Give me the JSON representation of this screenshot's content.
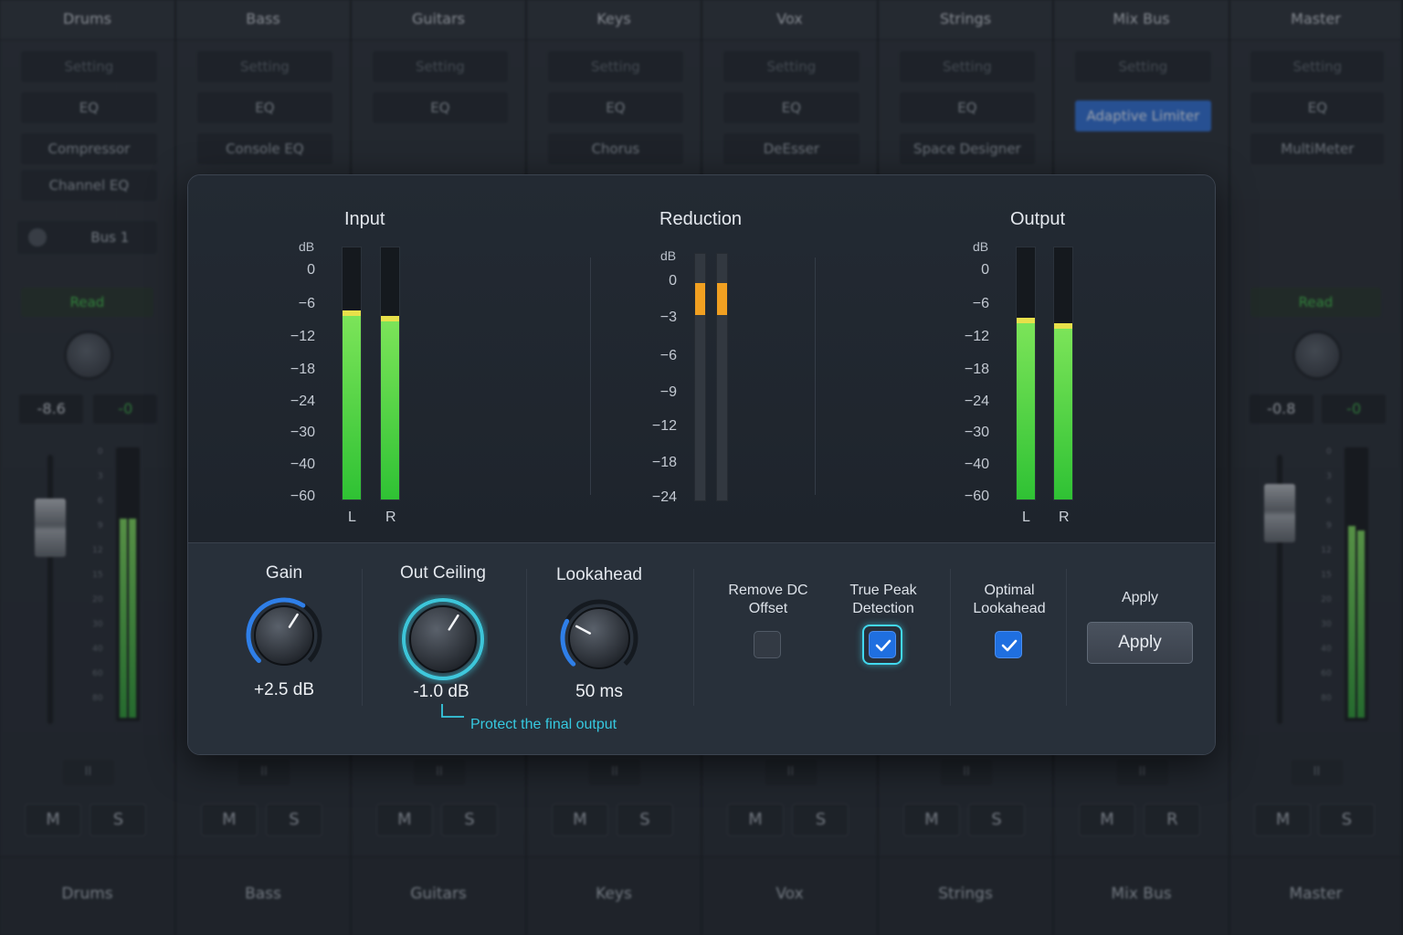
{
  "mixer": {
    "strips": [
      {
        "name": "Drums",
        "setting": "Setting",
        "slots": [
          "EQ",
          "Compressor",
          "Channel EQ"
        ],
        "bus": "Bus 1",
        "read": "Read",
        "volume": "-8.6",
        "volume2": "-0",
        "mute": "M",
        "solo": "S",
        "pause": "II"
      },
      {
        "name": "Bass",
        "setting": "Setting",
        "slots": [
          "EQ",
          "Console EQ"
        ],
        "mute": "M",
        "solo": "S",
        "pause": "II"
      },
      {
        "name": "Guitars",
        "setting": "Setting",
        "slots": [
          "EQ"
        ],
        "mute": "M",
        "solo": "S",
        "pause": "II"
      },
      {
        "name": "Keys",
        "setting": "Setting",
        "slots": [
          "EQ",
          "Chorus"
        ],
        "mute": "M",
        "solo": "S",
        "pause": "II"
      },
      {
        "name": "Vox",
        "setting": "Setting",
        "slots": [
          "EQ",
          "DeEsser"
        ],
        "mute": "M",
        "solo": "S",
        "pause": "II"
      },
      {
        "name": "Strings",
        "setting": "Setting",
        "slots": [
          "EQ",
          "Space Designer"
        ],
        "mute": "M",
        "solo": "S",
        "pause": "II"
      },
      {
        "name": "Mix Bus",
        "setting": "Setting",
        "slots": [
          "Adaptive Limiter"
        ],
        "mute": "M",
        "solo": "R",
        "pause": "II"
      },
      {
        "name": "Master",
        "setting": "Setting",
        "slots": [
          "EQ",
          "MultiMeter"
        ],
        "read": "Read",
        "volume": "-0.8",
        "volume2": "-0",
        "mute": "M",
        "solo": "S",
        "pause": "II"
      }
    ],
    "fader_scale": [
      "0",
      "3",
      "6",
      "9",
      "12",
      "15",
      "20",
      "30",
      "40",
      "60",
      "80"
    ]
  },
  "plugin": {
    "input": {
      "title": "Input",
      "unit": "dB",
      "ticks": [
        "0",
        "−6",
        "−12",
        "−18",
        "−24",
        "−30",
        "−40",
        "−60"
      ],
      "channels": [
        "L",
        "R"
      ],
      "levels": [
        0.75,
        0.73
      ]
    },
    "reduction": {
      "title": "Reduction",
      "unit": "dB",
      "ticks": [
        "0",
        "−3",
        "−6",
        "−9",
        "−12",
        "−18",
        "−24"
      ],
      "levels": [
        0.13,
        0.13
      ]
    },
    "output": {
      "title": "Output",
      "unit": "dB",
      "ticks": [
        "0",
        "−6",
        "−12",
        "−18",
        "−24",
        "−30",
        "−40",
        "−60"
      ],
      "channels": [
        "L",
        "R"
      ],
      "levels": [
        0.72,
        0.7
      ]
    },
    "controls": {
      "gain": {
        "title": "Gain",
        "value": "+2.5 dB",
        "level": 0.62
      },
      "ceiling": {
        "title": "Out Ceiling",
        "value": "-1.0 dB",
        "level": 0.62,
        "note": "Protect the final output"
      },
      "lookahead": {
        "title": "Lookahead",
        "value": "50 ms",
        "level": 0.27
      },
      "remove_dc": {
        "label_1": "Remove DC",
        "label_2": "Offset",
        "checked": false
      },
      "true_peak": {
        "label_1": "True Peak",
        "label_2": "Detection",
        "checked": true
      },
      "optimal_lookahead": {
        "label_1": "Optimal",
        "label_2": "Lookahead",
        "checked": true
      },
      "apply_label": "Apply",
      "apply_button": "Apply"
    },
    "colors": {
      "meter_green": "#2fc234",
      "reduction_orange": "#f1a021",
      "accent_cyan": "#36c9e0",
      "checkbox_blue": "#1f6fe0"
    }
  }
}
